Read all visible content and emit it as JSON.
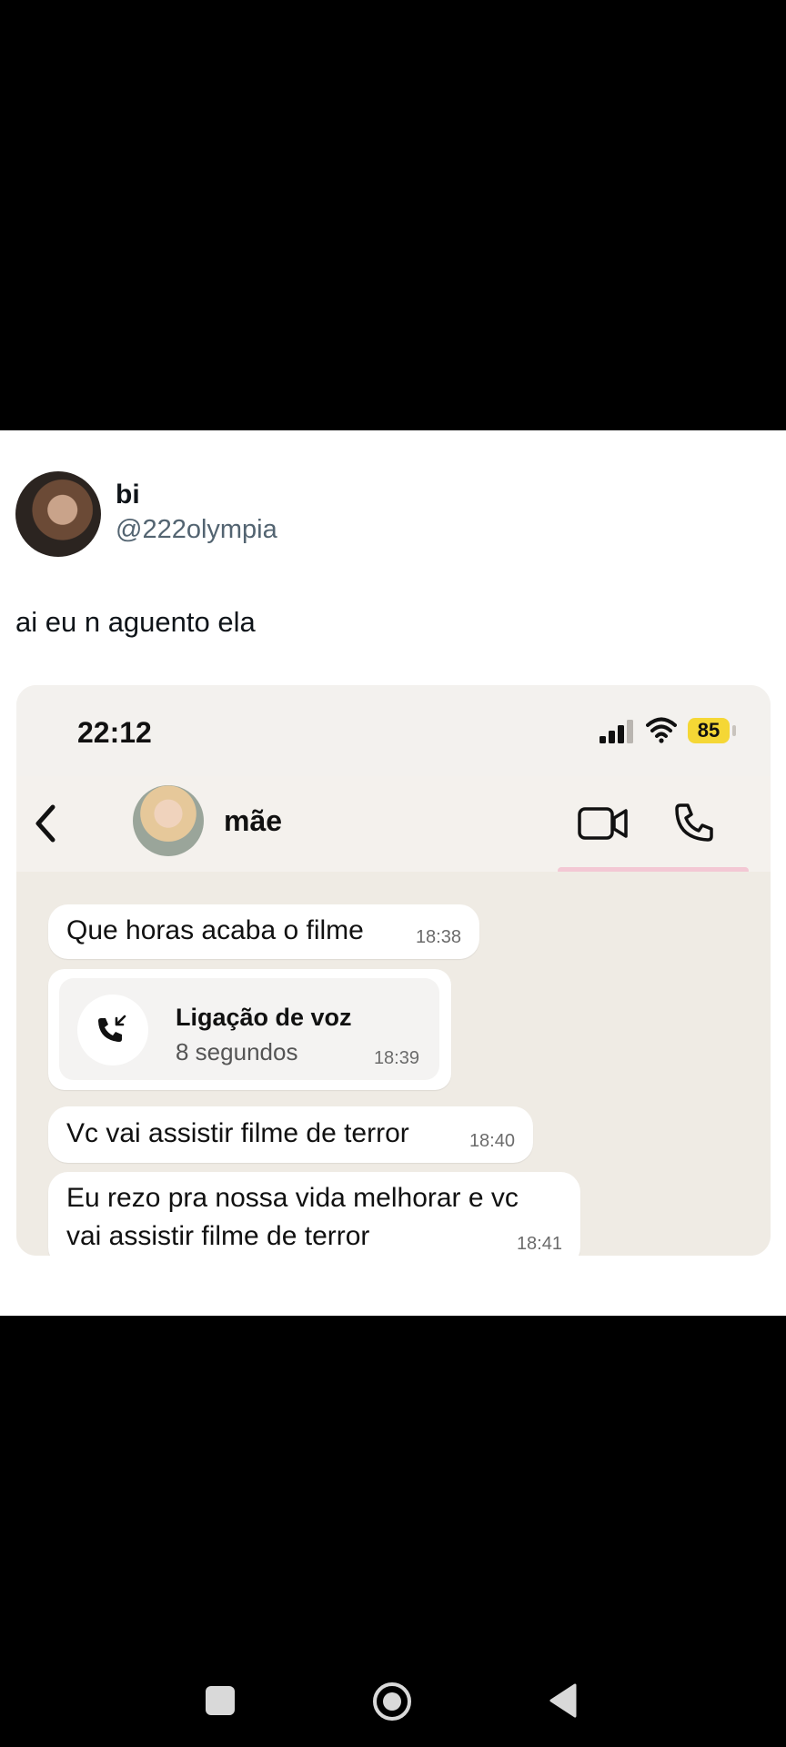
{
  "tweet": {
    "display_name": "bi",
    "handle": "@222olympia",
    "text": "ai eu n aguento ela"
  },
  "screenshot": {
    "status_bar": {
      "time": "22:12",
      "battery": "85"
    },
    "chat_header": {
      "contact_name": "mãe"
    },
    "messages": [
      {
        "text": "Que horas acaba o filme",
        "time": "18:38"
      },
      {
        "call_title": "Ligação de voz",
        "call_duration": "8 segundos",
        "time": "18:39"
      },
      {
        "text": "Vc vai assistir filme de terror",
        "time": "18:40"
      },
      {
        "text_line1": "Eu rezo pra nossa vida melhorar e vc",
        "text_line2": "vai assistir filme de terror",
        "time": "18:41"
      }
    ]
  },
  "icons": {
    "back": "chevron-left-icon",
    "video": "video-camera-icon",
    "phone": "phone-icon",
    "call": "incoming-call-icon"
  },
  "colors": {
    "battery": "#f5d735",
    "chat_background": "#efebe4",
    "bubble": "#ffffff"
  }
}
